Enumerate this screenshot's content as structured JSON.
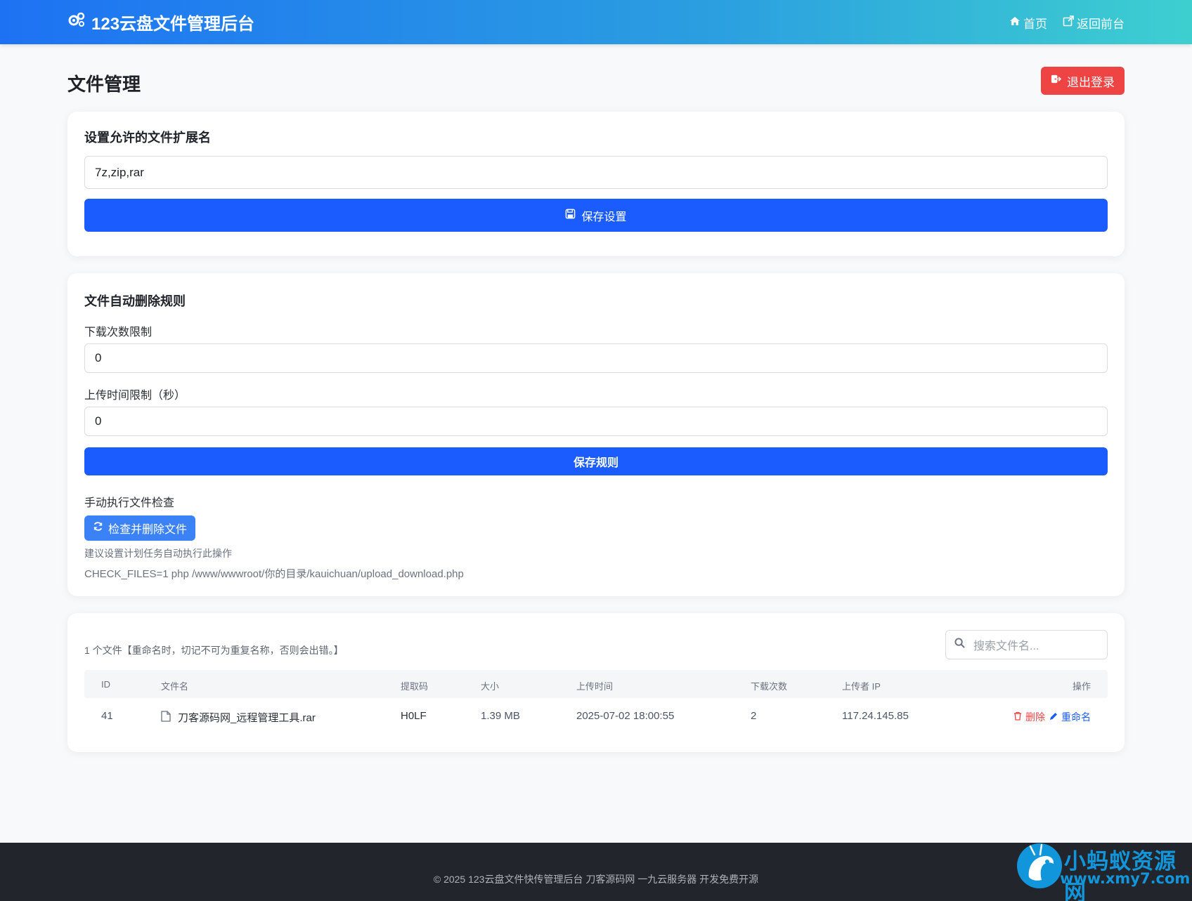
{
  "app": {
    "brand": "123云盘文件管理后台",
    "nav": {
      "home": "首页",
      "frontend": "返回前台"
    }
  },
  "page": {
    "title": "文件管理",
    "logout": "退出登录"
  },
  "extensions": {
    "title": "设置允许的文件扩展名",
    "value": "7z,zip,rar",
    "save": "保存设置"
  },
  "rules": {
    "title": "文件自动删除规则",
    "download_limit_label": "下载次数限制",
    "download_limit_value": "0",
    "time_limit_label": "上传时间限制（秒）",
    "time_limit_value": "0",
    "save": "保存规则",
    "manual_label": "手动执行文件检查",
    "check_button": "检查并删除文件",
    "hint": "建议设置计划任务自动执行此操作",
    "command": "CHECK_FILES=1 php /www/wwwroot/你的目录/kauichuan/upload_download.php"
  },
  "files": {
    "count_text": "1 个文件【重命名时，切记不可为重复名称，否则会出错。】",
    "search_placeholder": "搜索文件名...",
    "columns": [
      "ID",
      "文件名",
      "提取码",
      "大小",
      "上传时间",
      "下载次数",
      "上传者 IP",
      "操作"
    ],
    "rows": [
      {
        "id": "41",
        "name": "刀客源码网_远程管理工具.rar",
        "code": "H0LF",
        "size": "1.39 MB",
        "time": "2025-07-02 18:00:55",
        "downloads": "2",
        "ip": "117.24.145.85",
        "delete": "删除",
        "rename": "重命名"
      }
    ]
  },
  "footer": {
    "text": "© 2025 123云盘文件快传管理后台  刀客源码网  一九云服务器 开发免费开源"
  },
  "watermark": {
    "title": "小蚂蚁资源网",
    "url": "www.xmy7.com"
  },
  "colors": {
    "primary": "#1a5cff",
    "danger": "#ef4444",
    "info": "#3b82f6",
    "footer_bg": "#22252b"
  }
}
